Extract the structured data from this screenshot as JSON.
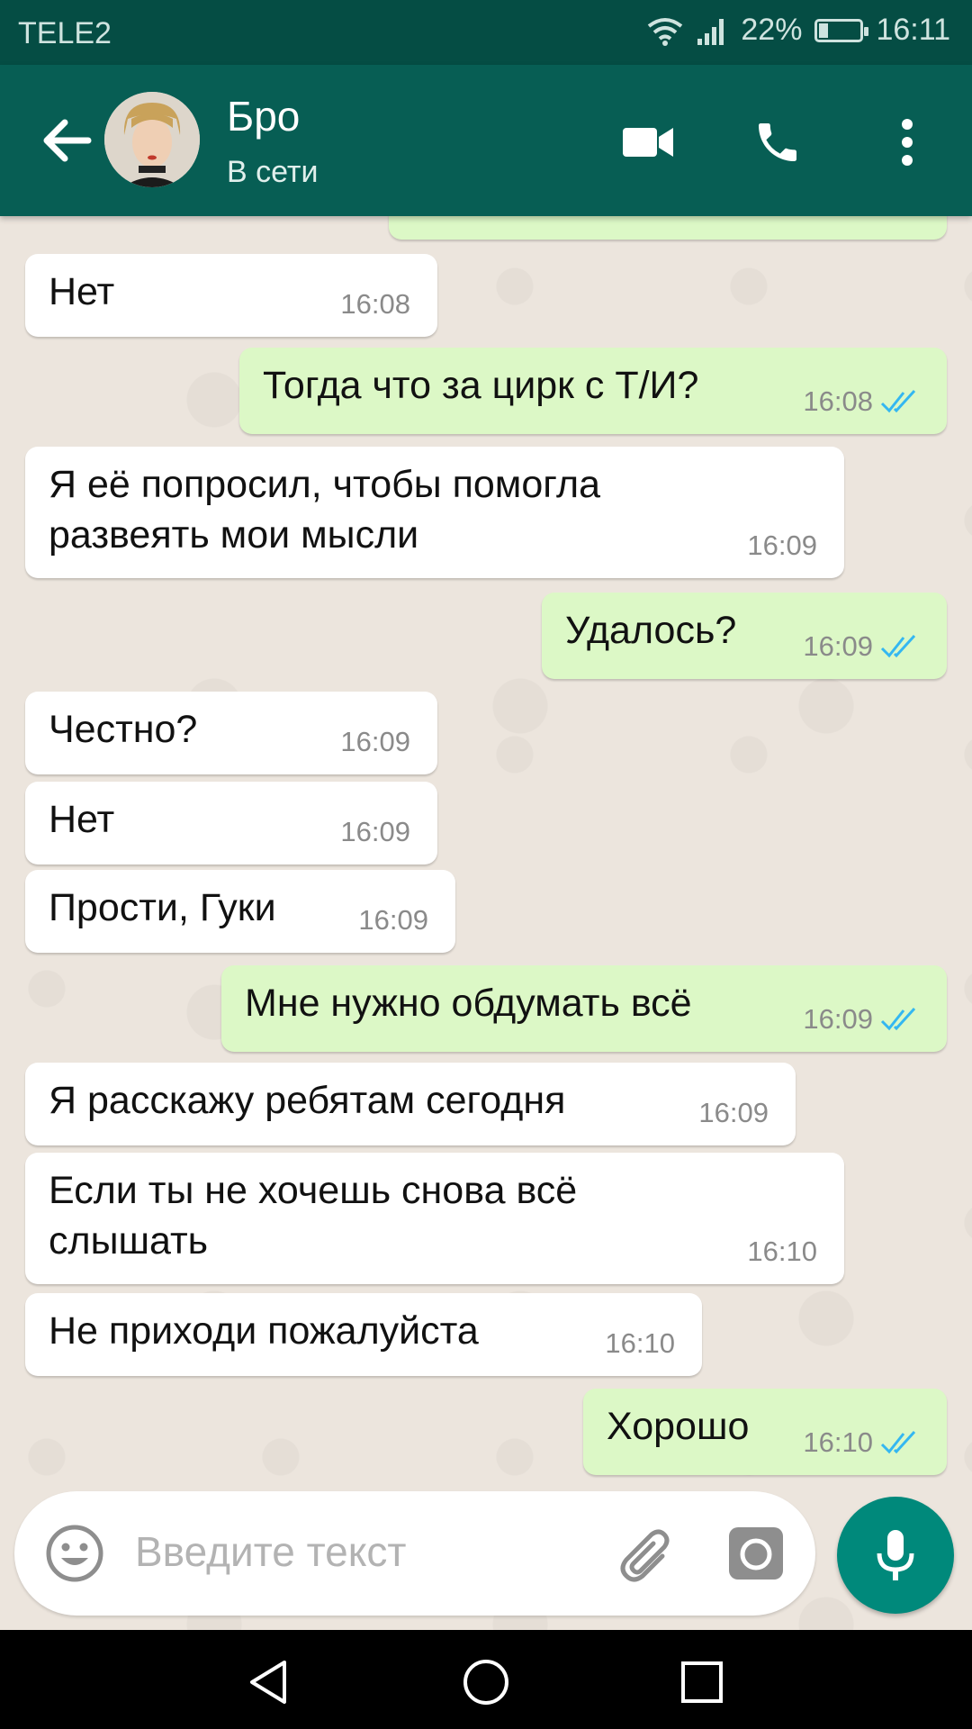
{
  "status_bar": {
    "carrier": "TELE2",
    "battery": "22%",
    "battery_level": 0.22,
    "time": "16:11"
  },
  "header": {
    "contact_name": "Бро",
    "status": "В сети"
  },
  "messages": [
    {
      "dir": "in",
      "text": "Нет",
      "time": "16:08"
    },
    {
      "dir": "out",
      "text": "Тогда что за цирк с Т/И?",
      "time": "16:08"
    },
    {
      "dir": "in",
      "text": "Я её попросил, чтобы помогла развеять мои мысли",
      "time": "16:09"
    },
    {
      "dir": "out",
      "text": "Удалось?",
      "time": "16:09"
    },
    {
      "dir": "in",
      "text": "Честно?",
      "time": "16:09"
    },
    {
      "dir": "in",
      "text": "Нет",
      "time": "16:09"
    },
    {
      "dir": "in",
      "text": "Прости, Гуки",
      "time": "16:09"
    },
    {
      "dir": "out",
      "text": "Мне нужно обдумать всё",
      "time": "16:09"
    },
    {
      "dir": "in",
      "text": "Я расскажу ребятам сегодня",
      "time": "16:09"
    },
    {
      "dir": "in",
      "text": "Если ты не хочешь снова всё слышать",
      "time": "16:10"
    },
    {
      "dir": "in",
      "text": "Не приходи пожалуйста",
      "time": "16:10"
    },
    {
      "dir": "out",
      "text": "Хорошо",
      "time": "16:10"
    }
  ],
  "composer": {
    "placeholder": "Введите текст"
  },
  "icons": [
    "back-arrow-icon",
    "video-call-icon",
    "phone-icon",
    "more-vert-icon",
    "emoji-icon",
    "attach-icon",
    "camera-icon",
    "mic-icon",
    "nav-back-icon",
    "nav-home-icon",
    "nav-recents-icon",
    "wifi-icon",
    "signal-icon",
    "battery-icon",
    "double-check-icon"
  ],
  "colors": {
    "header": "#075e54",
    "status_bar": "#054d44",
    "outgoing_bubble": "#dcf8c6",
    "incoming_bubble": "#ffffff",
    "read_tick": "#34b7f1",
    "mic_button": "#00897b"
  }
}
